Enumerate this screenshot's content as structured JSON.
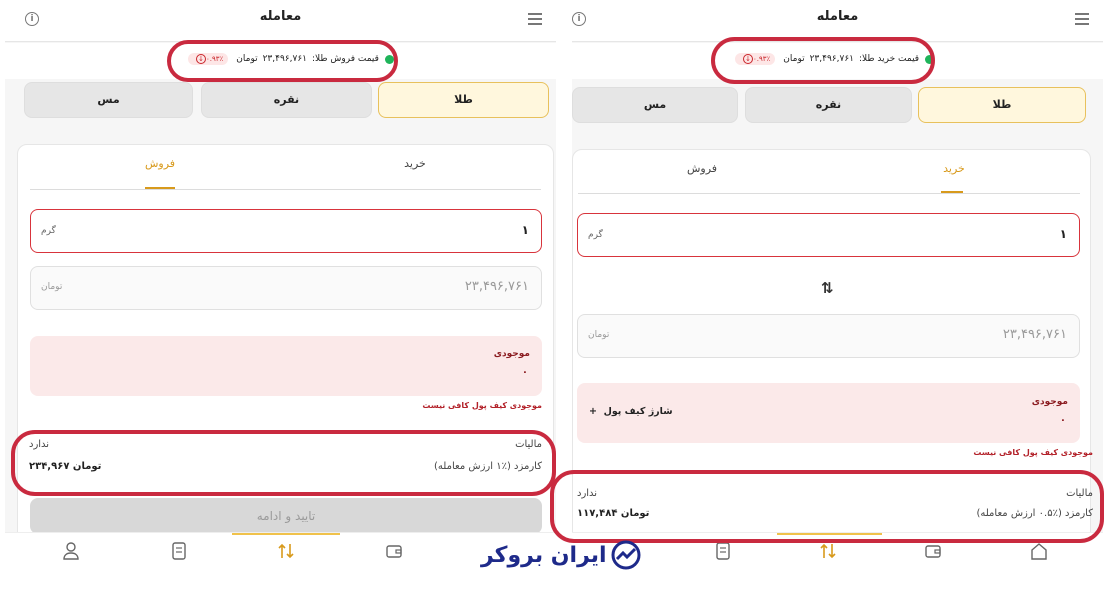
{
  "left": {
    "title": "معامله",
    "price_label": "قیمت فروش طلا:",
    "price_value": "۲۳,۴۹۶,۷۶۱",
    "price_unit": "تومان",
    "change": "۰.۹۳٪",
    "segments": [
      "طلا",
      "نقره",
      "مس"
    ],
    "tabs": [
      "خرید",
      "فروش"
    ],
    "active_tab": "فروش",
    "gram_value": "۱",
    "gram_unit": "گرم",
    "toman_value": "۲۳,۴۹۶,۷۶۱",
    "toman_unit": "تومان",
    "balance_label": "موجودی",
    "balance_value": "۰",
    "error_text": "موجودی کیف پول کافی نیست",
    "tax_label": "مالیات",
    "tax_value": "ندارد",
    "fee_label": "کارمزد (٪۱ ارزش معامله)",
    "fee_value": "۲۳۴,۹۶۷ تومان",
    "confirm_label": "تایید و ادامه"
  },
  "right": {
    "title": "معامله",
    "price_label": "قیمت خرید طلا:",
    "price_value": "۲۳,۴۹۶,۷۶۱",
    "price_unit": "تومان",
    "change": "۰.۹۳٪",
    "segments": [
      "طلا",
      "نقره",
      "مس"
    ],
    "tabs": [
      "خرید",
      "فروش"
    ],
    "active_tab": "خرید",
    "gram_value": "۱",
    "gram_unit": "گرم",
    "swap_glyph": "⇅",
    "toman_value": "۲۳,۴۹۶,۷۶۱",
    "toman_unit": "تومان",
    "balance_label": "موجودی",
    "balance_value": "۰",
    "charge_label": "شارژ کیف پول",
    "charge_plus": "+",
    "error_text": "موجودی کیف پول کافی نیست",
    "tax_label": "مالیات",
    "tax_value": "ندارد",
    "fee_label": "کارمزد (٪۰.۵ ارزش معامله)",
    "fee_value": "۱۱۷,۴۸۴ تومان"
  },
  "watermark": "ایران بروکر",
  "colors": {
    "accent": "#d89a1c",
    "highlight_box": "#c92a3f",
    "error_border": "#d8343c",
    "positive_dot": "#1fb45a",
    "logo": "#1e2a8a"
  },
  "icons": [
    "info-icon",
    "menu-icon",
    "down-arrow-icon",
    "profile-icon",
    "receipt-icon",
    "swap-icon",
    "wallet-icon",
    "home-icon",
    "ascending-chart-logo-icon"
  ]
}
